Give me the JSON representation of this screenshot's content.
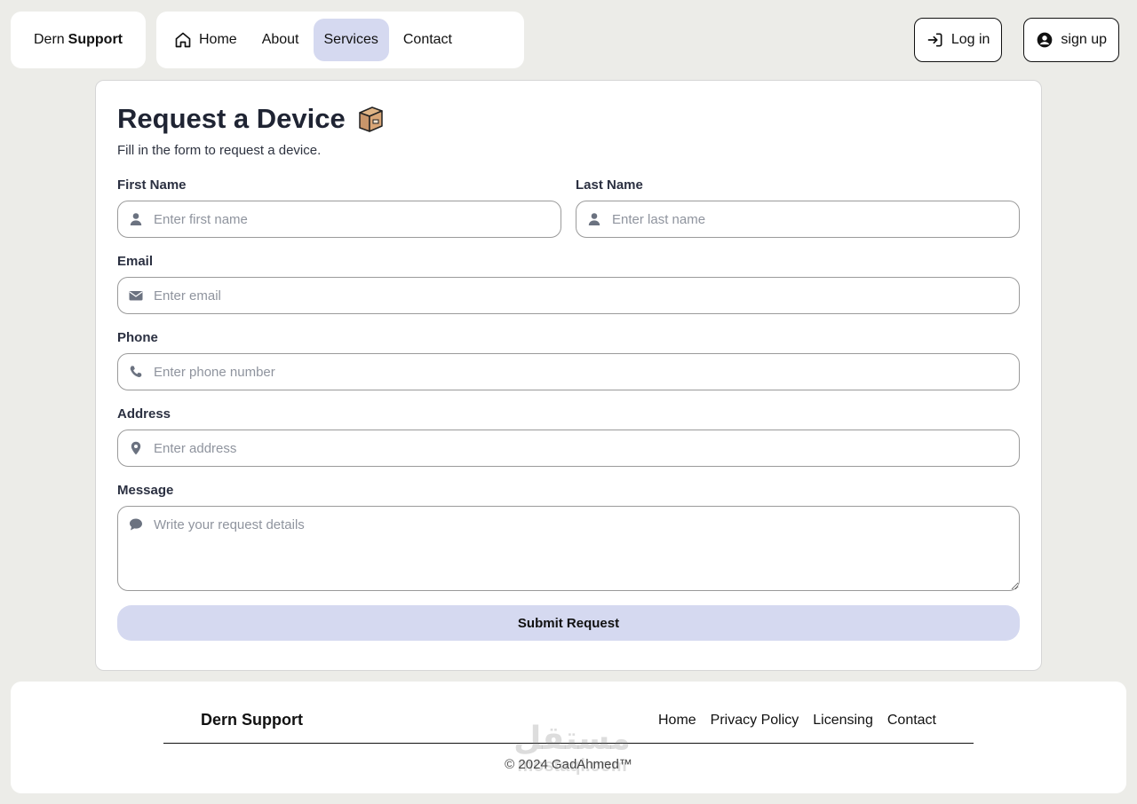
{
  "brand": {
    "part1": "Dern",
    "part2": "Support"
  },
  "nav": {
    "items": [
      {
        "label": "Home",
        "icon": "home-icon"
      },
      {
        "label": "About"
      },
      {
        "label": "Services",
        "active": true
      },
      {
        "label": "Contact"
      }
    ]
  },
  "auth": {
    "login_label": "Log in",
    "signup_label": "sign up"
  },
  "form": {
    "title": "Request a Device",
    "subtitle": "Fill in the form to request a device.",
    "first_name": {
      "label": "First Name",
      "placeholder": "Enter first name"
    },
    "last_name": {
      "label": "Last Name",
      "placeholder": "Enter last name"
    },
    "email": {
      "label": "Email",
      "placeholder": "Enter email"
    },
    "phone": {
      "label": "Phone",
      "placeholder": "Enter phone number"
    },
    "address": {
      "label": "Address",
      "placeholder": "Enter address"
    },
    "message": {
      "label": "Message",
      "placeholder": "Write your request details"
    },
    "submit_label": "Submit Request"
  },
  "footer": {
    "brand": "Dern Support",
    "links": [
      "Home",
      "Privacy Policy",
      "Licensing",
      "Contact"
    ],
    "copyright": "© 2024 GadAhmed™"
  },
  "watermark": {
    "arabic": "مستقل",
    "latin": "mostaql.com"
  },
  "colors": {
    "accent": "#d5d9f0",
    "background": "#ecece8",
    "heading": "#1f2433"
  }
}
